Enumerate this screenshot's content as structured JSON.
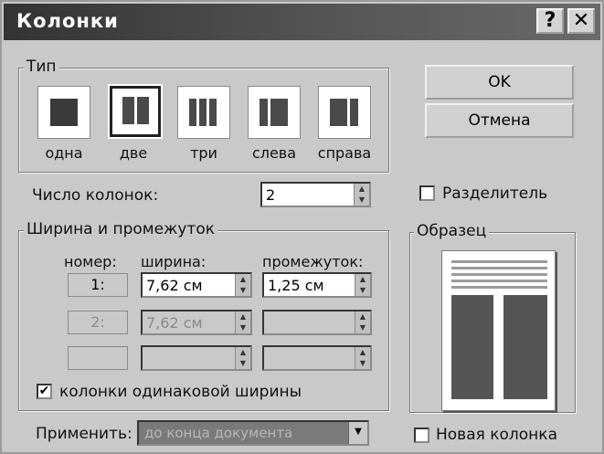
{
  "dialog": {
    "title": "Колонки",
    "help_label": "?",
    "close_label": "✕"
  },
  "type_group": {
    "label": "Тип",
    "presets": [
      {
        "label": "одна",
        "selected": false
      },
      {
        "label": "две",
        "selected": true
      },
      {
        "label": "три",
        "selected": false
      },
      {
        "label": "слева",
        "selected": false
      },
      {
        "label": "справа",
        "selected": false
      }
    ]
  },
  "buttons": {
    "ok": "OK",
    "cancel": "Отмена"
  },
  "columns_count": {
    "label": "Число колонок:",
    "value": "2"
  },
  "separator": {
    "label": "Разделитель",
    "checked": false
  },
  "width_group": {
    "label": "Ширина и промежуток",
    "headers": {
      "number": "номер:",
      "width": "ширина:",
      "spacing": "промежуток:"
    },
    "rows": [
      {
        "number": "1:",
        "width": "7,62 см",
        "spacing": "1,25 см",
        "enabled": true
      },
      {
        "number": "2:",
        "width": "7,62 см",
        "spacing": "",
        "enabled": false
      },
      {
        "number": "",
        "width": "",
        "spacing": "",
        "enabled": false
      }
    ],
    "equal_width": {
      "label": "колонки одинаковой ширины",
      "checked": true
    }
  },
  "preview": {
    "label": "Образец"
  },
  "apply": {
    "label": "Применить:",
    "value": "до конца документа"
  },
  "new_column": {
    "label": "Новая колонка",
    "checked": false
  },
  "colors": {
    "dialog_bg": "#c9c9c9",
    "titlebar": "#333333",
    "text": "#111111"
  }
}
